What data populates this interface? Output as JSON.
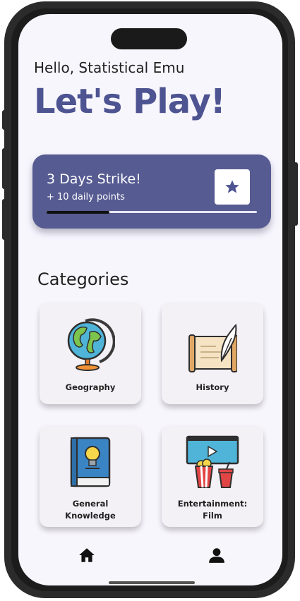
{
  "greeting": "Hello, Statistical Emu",
  "headline": "Let's Play!",
  "streak": {
    "title": "3 Days Strike!",
    "subtitle": "+ 10 daily points",
    "progress": 0.3,
    "icon": "star-icon",
    "color": "#565b92"
  },
  "categories": {
    "title": "Categories",
    "items": [
      {
        "label": "Geography",
        "icon": "globe-icon"
      },
      {
        "label": "History",
        "icon": "scroll-quill-icon"
      },
      {
        "label_line1": "General",
        "label_line2": "Knowledge",
        "icon": "book-lightbulb-icon"
      },
      {
        "label_line1": "Entertainment:",
        "label_line2": "Film",
        "icon": "movie-popcorn-icon"
      }
    ]
  },
  "nav": {
    "items": [
      {
        "icon": "home-icon"
      },
      {
        "icon": "profile-icon"
      }
    ]
  },
  "colors": {
    "accent": "#4d5491",
    "background": "#f8f6fd"
  }
}
